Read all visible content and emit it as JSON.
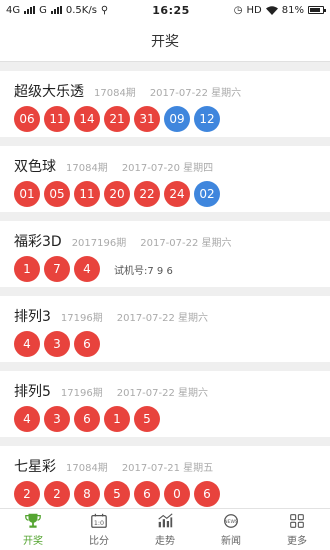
{
  "status": {
    "network": "4G",
    "carrier": "G",
    "speed": "0.5K/s",
    "time": "16:25",
    "hd": "HD",
    "battery": "81%"
  },
  "header": {
    "title": "开奖"
  },
  "lotteries": [
    {
      "name": "超级大乐透",
      "issue": "17084期",
      "date": "2017-07-22 星期六",
      "red": [
        "06",
        "11",
        "14",
        "21",
        "31"
      ],
      "blue": [
        "09",
        "12"
      ]
    },
    {
      "name": "双色球",
      "issue": "17084期",
      "date": "2017-07-20 星期四",
      "red": [
        "01",
        "05",
        "11",
        "20",
        "22",
        "24"
      ],
      "blue": [
        "02"
      ]
    },
    {
      "name": "福彩3D",
      "issue": "2017196期",
      "date": "2017-07-22 星期六",
      "red": [
        "1",
        "7",
        "4"
      ],
      "trial": "试机号:7 9 6"
    },
    {
      "name": "排列3",
      "issue": "17196期",
      "date": "2017-07-22 星期六",
      "red": [
        "4",
        "3",
        "6"
      ]
    },
    {
      "name": "排列5",
      "issue": "17196期",
      "date": "2017-07-22 星期六",
      "red": [
        "4",
        "3",
        "6",
        "1",
        "5"
      ]
    },
    {
      "name": "七星彩",
      "issue": "17084期",
      "date": "2017-07-21 星期五",
      "red": [
        "2",
        "2",
        "8",
        "5",
        "6",
        "0",
        "6"
      ]
    }
  ],
  "tabs": [
    {
      "label": "开奖",
      "icon": "trophy-icon"
    },
    {
      "label": "比分",
      "icon": "scoreboard-icon"
    },
    {
      "label": "走势",
      "icon": "chart-icon"
    },
    {
      "label": "新闻",
      "icon": "news-icon"
    },
    {
      "label": "更多",
      "icon": "grid-icon"
    }
  ],
  "colors": {
    "red_ball": "#e8433d",
    "blue_ball": "#3f86dd",
    "active_tab": "#55a532"
  }
}
